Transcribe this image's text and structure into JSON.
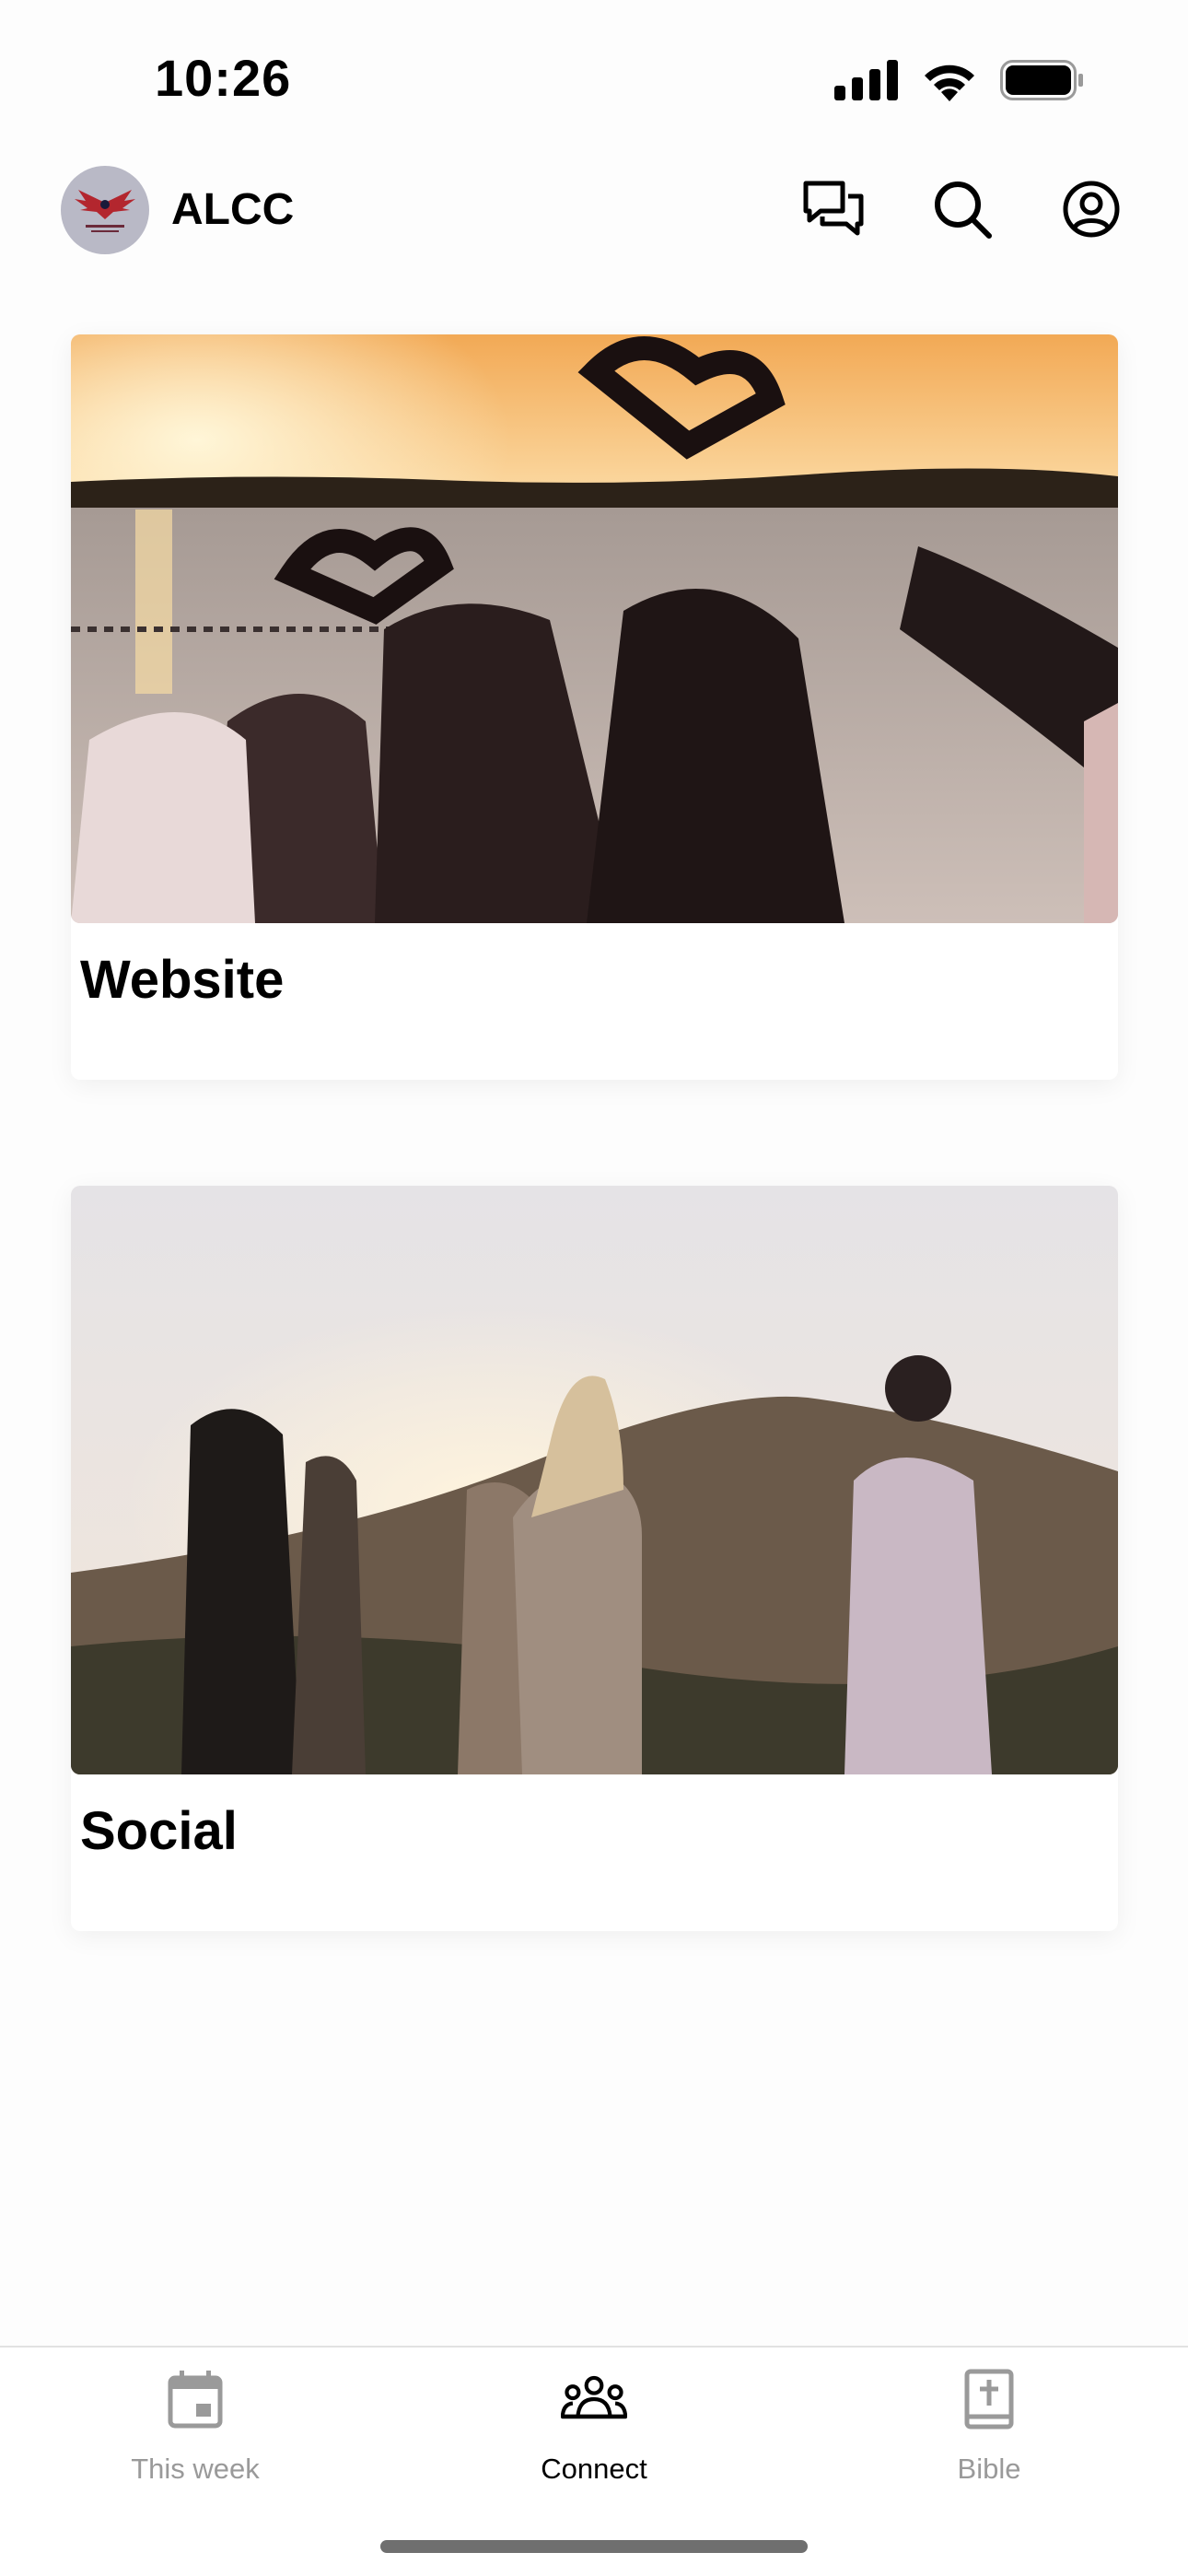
{
  "status_bar": {
    "time": "10:26"
  },
  "header": {
    "title": "ALCC"
  },
  "cards": [
    {
      "title": "Website"
    },
    {
      "title": "Social"
    }
  ],
  "tabs": [
    {
      "label": "This week",
      "icon": "calendar-icon",
      "active": false
    },
    {
      "label": "Connect",
      "icon": "people-group-icon",
      "active": true
    },
    {
      "label": "Bible",
      "icon": "bible-icon",
      "active": false
    }
  ],
  "colors": {
    "active_tab": "#000000",
    "inactive_tab": "#9a9a9a",
    "avatar_bg": "#b9b9c6",
    "logo_red": "#b3262e"
  }
}
